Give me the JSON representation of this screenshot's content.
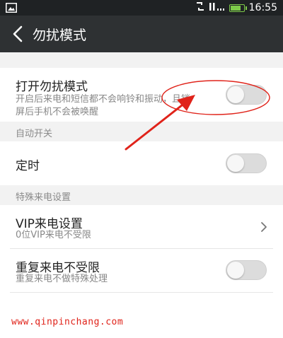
{
  "status_bar": {
    "time": "16:55",
    "icons": [
      "image-icon",
      "sync-icon",
      "signal-icon",
      "battery-icon"
    ],
    "battery_level": 0.85
  },
  "app_bar": {
    "title": "勿扰模式",
    "back_icon": "chevron-left-icon"
  },
  "items": {
    "dnd": {
      "title": "打开勿扰模式",
      "subtitle_line1": "开启后来电和短信都不会响铃和振动，且锁",
      "subtitle_line2": "屏后手机不会被唤醒",
      "toggle_on": false
    },
    "auto_switch_header": "自动开关",
    "timer": {
      "title": "定时",
      "toggle_on": false
    },
    "special_header": "特殊来电设置",
    "vip": {
      "title": "VIP来电设置",
      "subtitle": "0位VIP来电不受限"
    },
    "repeat": {
      "title": "重复来电不受限",
      "subtitle": "重复来电不做特殊处理",
      "toggle_on": false
    }
  },
  "watermark": "www.qinpinchang.com",
  "colors": {
    "status_bar_bg": "#1f2224",
    "app_bar_bg": "#2e3133",
    "section_bg": "#f2f2f2",
    "annotation_red": "#e0231a",
    "battery_green": "#7ecb4a"
  }
}
